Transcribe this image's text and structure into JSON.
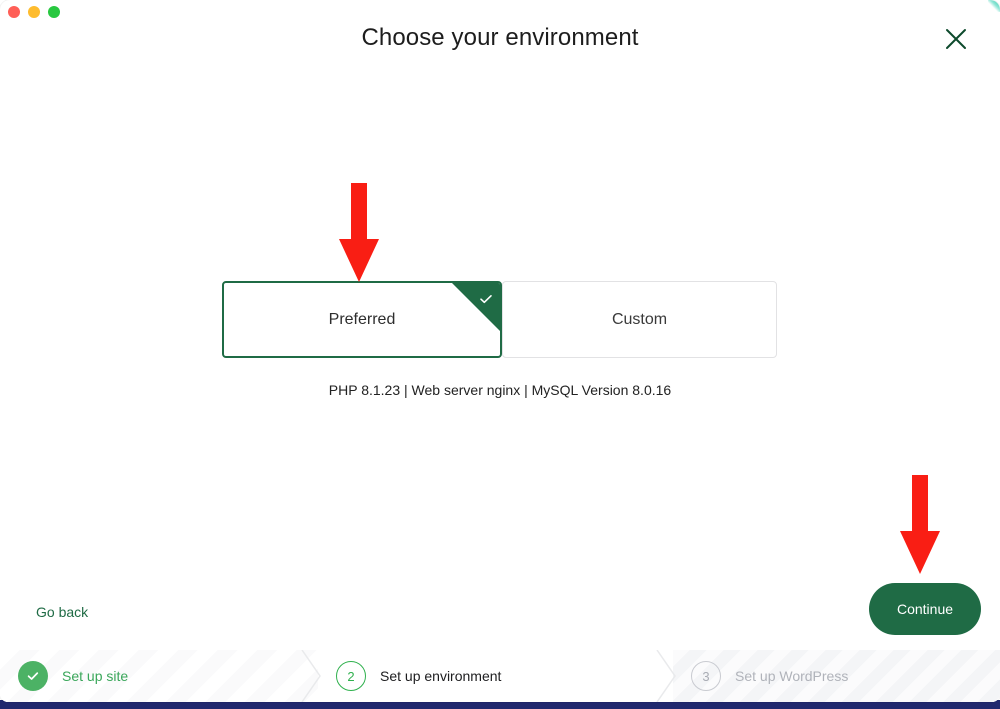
{
  "window": {
    "title": "Choose your environment",
    "traffic_lights": [
      "close-red",
      "minimize-yellow",
      "zoom-green"
    ],
    "close_icon": "close-icon"
  },
  "environment": {
    "options": [
      {
        "label": "Preferred",
        "selected": true,
        "check_icon": "check-icon"
      },
      {
        "label": "Custom",
        "selected": false
      }
    ],
    "info_line": "PHP 8.1.23 | Web server nginx | MySQL Version 8.0.16"
  },
  "actions": {
    "go_back_label": "Go back",
    "continue_label": "Continue"
  },
  "stepper": {
    "steps": [
      {
        "marker": "✓",
        "label": "Set up site",
        "state": "done"
      },
      {
        "marker": "2",
        "label": "Set up environment",
        "state": "active"
      },
      {
        "marker": "3",
        "label": "Set up WordPress",
        "state": "todo"
      }
    ]
  },
  "annotations": {
    "arrows": [
      {
        "name": "arrow-pointing-to-preferred-card",
        "direction": "down",
        "color": "#f91e14"
      },
      {
        "name": "arrow-pointing-to-continue-button",
        "direction": "down",
        "color": "#f91e14"
      }
    ]
  },
  "colors": {
    "brand_green": "#1f6b45",
    "step_done_green": "#4cb265",
    "step_active_green": "#30b14e",
    "annotation_red": "#f91e14",
    "card_border_inactive": "#e2e2e4",
    "behind_window": "#20286e"
  }
}
